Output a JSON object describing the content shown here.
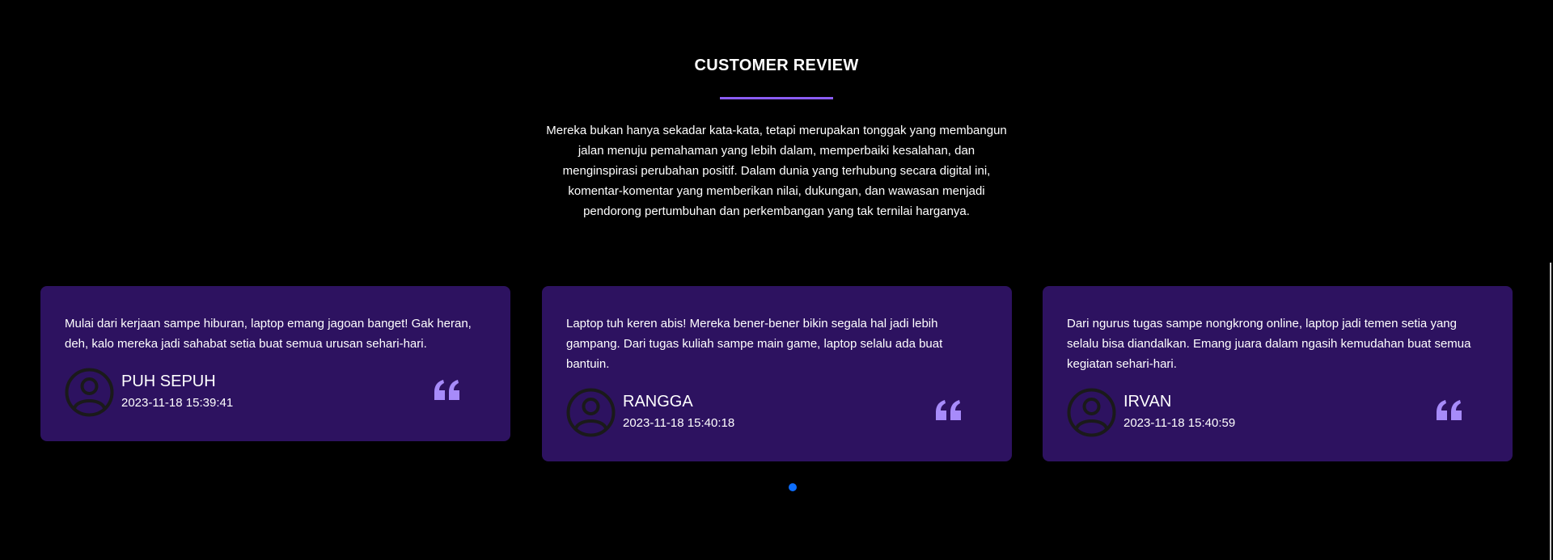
{
  "review_section": {
    "title": "CUSTOMER REVIEW",
    "intro": "Mereka bukan hanya sekadar kata-kata, tetapi merupakan tonggak yang membangun jalan menuju pemahaman yang lebih dalam, memperbaiki kesalahan, dan menginspirasi perubahan positif. Dalam dunia yang terhubung secara digital ini, komentar-komentar yang memberikan nilai, dukungan, dan wawasan menjadi pendorong pertumbuhan dan perkembangan yang tak ternilai harganya.",
    "reviews": [
      {
        "text": "Mulai dari kerjaan sampe hiburan, laptop emang jagoan banget! Gak heran, deh, kalo mereka jadi sahabat setia buat semua urusan sehari-hari.",
        "name": "PUH SEPUH",
        "date": "2023-11-18 15:39:41",
        "avatar_icon": "user-circle-icon",
        "quote_icon": "quote-icon"
      },
      {
        "text": "Laptop tuh keren abis! Mereka bener-bener bikin segala hal jadi lebih gampang. Dari tugas kuliah sampe main game, laptop selalu ada buat bantuin.",
        "name": "RANGGA",
        "date": "2023-11-18 15:40:18",
        "avatar_icon": "user-circle-icon",
        "quote_icon": "quote-icon"
      },
      {
        "text": "Dari ngurus tugas sampe nongkrong online, laptop jadi temen setia yang selalu bisa diandalkan. Emang juara dalam ngasih kemudahan buat semua kegiatan sehari-hari.",
        "name": "IRVAN",
        "date": "2023-11-18 15:40:59",
        "avatar_icon": "user-circle-icon",
        "quote_icon": "quote-icon"
      }
    ],
    "pagination": {
      "dot_count": 1,
      "active_index": 0
    }
  },
  "colors": {
    "background": "#000000",
    "card_background": "#2d1260",
    "accent": "#8b5cf6",
    "quote": "#a78bfa",
    "avatar_stroke": "#1a1a1a",
    "pagination_active": "#0d6efd",
    "text": "#ffffff"
  }
}
